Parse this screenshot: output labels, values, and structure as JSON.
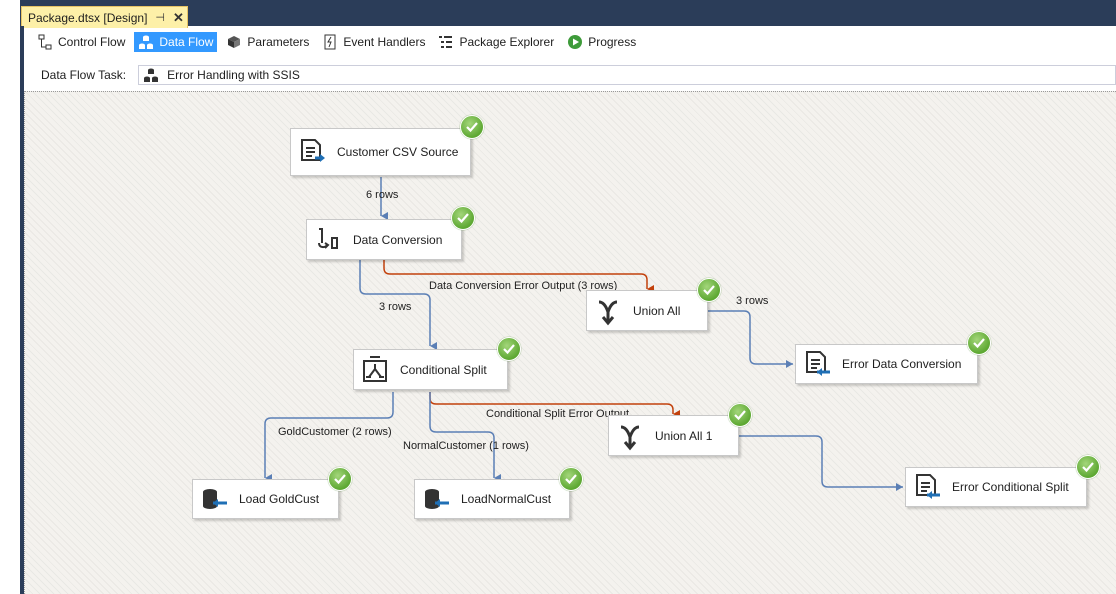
{
  "document_tab": {
    "title": "Package.dtsx [Design]",
    "pin": "⊣",
    "close": "✕"
  },
  "designer_tabs": [
    {
      "label": "Control Flow",
      "icon": "control-flow-icon"
    },
    {
      "label": "Data Flow",
      "icon": "data-flow-icon",
      "active": true
    },
    {
      "label": "Parameters",
      "icon": "parameters-icon"
    },
    {
      "label": "Event Handlers",
      "icon": "event-handlers-icon"
    },
    {
      "label": "Package Explorer",
      "icon": "package-explorer-icon"
    },
    {
      "label": "Progress",
      "icon": "progress-icon"
    }
  ],
  "task_bar": {
    "label": "Data Flow Task:",
    "selected_task": "Error Handling with SSIS"
  },
  "colors": {
    "normal_path": "#5b7fb5",
    "error_path": "#c2410c",
    "success": "#5da832",
    "active_tab": "#3399ff"
  },
  "components": [
    {
      "id": "customer-csv-source",
      "label": "Customer CSV Source",
      "icon": "flat-file-source-icon",
      "status": "success"
    },
    {
      "id": "data-conversion",
      "label": "Data Conversion",
      "icon": "data-conversion-icon",
      "status": "success"
    },
    {
      "id": "union-all",
      "label": "Union All",
      "icon": "union-all-icon",
      "status": "success"
    },
    {
      "id": "error-data-conversion",
      "label": "Error Data Conversion",
      "icon": "flat-file-destination-icon",
      "status": "success"
    },
    {
      "id": "conditional-split",
      "label": "Conditional Split",
      "icon": "conditional-split-icon",
      "status": "success"
    },
    {
      "id": "union-all-1",
      "label": "Union All 1",
      "icon": "union-all-icon",
      "status": "success"
    },
    {
      "id": "error-conditional-split",
      "label": "Error Conditional Split",
      "icon": "flat-file-destination-icon",
      "status": "success"
    },
    {
      "id": "load-goldcust",
      "label": "Load GoldCust",
      "icon": "db-destination-icon",
      "status": "success"
    },
    {
      "id": "load-normalcust",
      "label": "LoadNormalCust",
      "icon": "db-destination-icon",
      "status": "success"
    }
  ],
  "paths": [
    {
      "from": "customer-csv-source",
      "to": "data-conversion",
      "type": "normal",
      "label": "6 rows"
    },
    {
      "from": "data-conversion",
      "to": "union-all",
      "type": "error",
      "label": "Data Conversion Error Output (3 rows)"
    },
    {
      "from": "data-conversion",
      "to": "conditional-split",
      "type": "normal",
      "label": "3 rows"
    },
    {
      "from": "union-all",
      "to": "error-data-conversion",
      "type": "normal",
      "label": "3 rows"
    },
    {
      "from": "conditional-split",
      "to": "union-all-1",
      "type": "error",
      "label": "Conditional Split Error Output"
    },
    {
      "from": "conditional-split",
      "to": "load-goldcust",
      "type": "normal",
      "label": "GoldCustomer (2 rows)"
    },
    {
      "from": "conditional-split",
      "to": "load-normalcust",
      "type": "normal",
      "label": "NormalCustomer (1 rows)"
    },
    {
      "from": "union-all-1",
      "to": "error-conditional-split",
      "type": "normal",
      "label": ""
    }
  ]
}
